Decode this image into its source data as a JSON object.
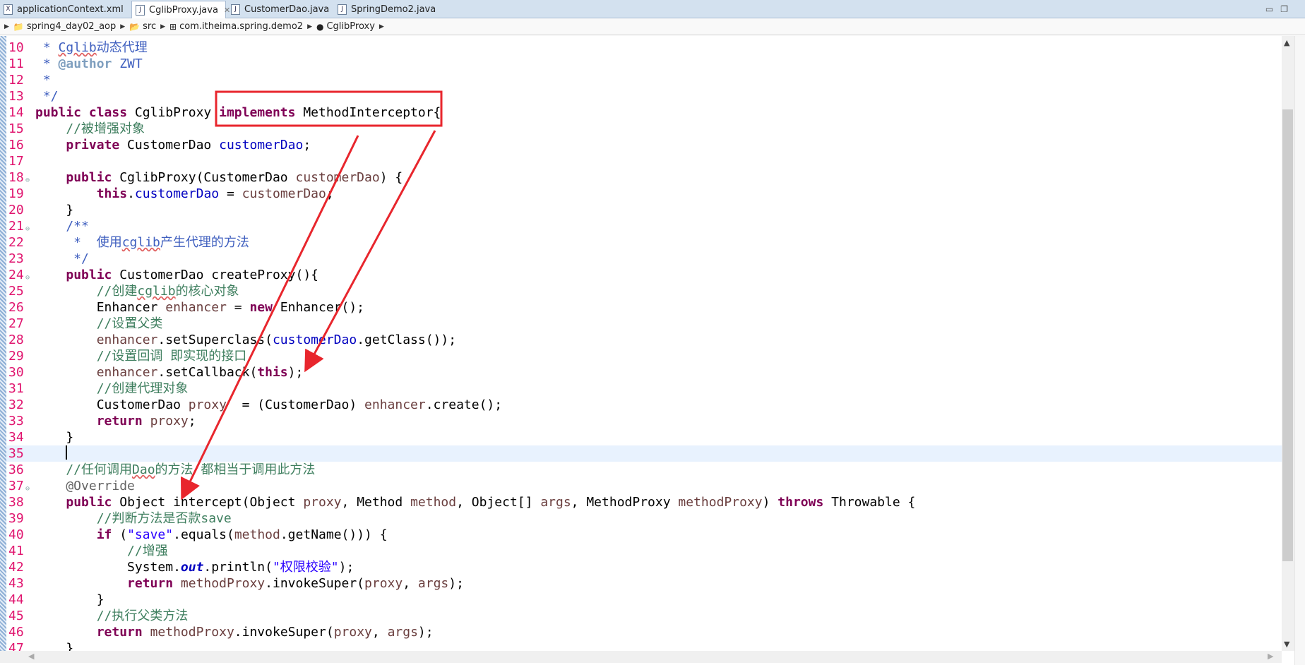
{
  "tabs": [
    {
      "label": "applicationContext.xml",
      "icon": "xml-file-icon",
      "glyph": "X",
      "active": false
    },
    {
      "label": "CglibProxy.java",
      "icon": "java-file-icon",
      "glyph": "J",
      "active": true,
      "close": "✕"
    },
    {
      "label": "CustomerDao.java",
      "icon": "java-file-icon",
      "glyph": "J",
      "active": false
    },
    {
      "label": "SpringDemo2.java",
      "icon": "java-file-icon",
      "glyph": "J",
      "active": false
    }
  ],
  "window_controls": {
    "minimize": "▭",
    "restore": "❐"
  },
  "breadcrumb": [
    {
      "label": "spring4_day02_aop",
      "icon": "project-icon",
      "glyph": "📁"
    },
    {
      "label": "src",
      "icon": "source-folder-icon",
      "glyph": "📂"
    },
    {
      "label": "com.itheima.spring.demo2",
      "icon": "package-icon",
      "glyph": "⊞"
    },
    {
      "label": "CglibProxy",
      "icon": "class-icon",
      "glyph": "●"
    }
  ],
  "colors": {
    "annotation": "#e8262d",
    "keyword": "#7f0055",
    "comment": "#3f7f5f",
    "line_number": "#e0146e"
  },
  "code": {
    "first_line": 10,
    "current_line": 35,
    "folds": [
      18,
      21,
      24,
      37
    ],
    "lines": [
      [
        [
          " * ",
          "jd"
        ],
        [
          "Cglib",
          "jd sq"
        ],
        [
          "动态代理",
          "jd"
        ]
      ],
      [
        [
          " * ",
          "jd"
        ],
        [
          "@author",
          "tag"
        ],
        [
          " ZWT",
          "jd"
        ]
      ],
      [
        [
          " *",
          "jd"
        ]
      ],
      [
        [
          " */",
          "jd"
        ]
      ],
      [
        [
          "public",
          "kw"
        ],
        [
          " ",
          ""
        ],
        [
          "class",
          "kw"
        ],
        [
          " CglibProxy ",
          ""
        ],
        [
          "implements",
          "kw"
        ],
        [
          " MethodInterceptor{",
          ""
        ]
      ],
      [
        [
          "    //被增强对象",
          "cm"
        ]
      ],
      [
        [
          "    ",
          ""
        ],
        [
          "private",
          "kw"
        ],
        [
          " CustomerDao ",
          ""
        ],
        [
          "customerDao",
          "fld"
        ],
        [
          ";",
          ""
        ]
      ],
      [],
      [
        [
          "    ",
          ""
        ],
        [
          "public",
          "kw"
        ],
        [
          " CglibProxy(CustomerDao ",
          ""
        ],
        [
          "customerDao",
          "loc"
        ],
        [
          ") {",
          ""
        ]
      ],
      [
        [
          "        ",
          ""
        ],
        [
          "this",
          "kw"
        ],
        [
          ".",
          ""
        ],
        [
          "customerDao",
          "fld"
        ],
        [
          " = ",
          ""
        ],
        [
          "customerDao",
          "loc"
        ],
        [
          ";",
          ""
        ]
      ],
      [
        [
          "    }",
          ""
        ]
      ],
      [
        [
          "    /**",
          "jd"
        ]
      ],
      [
        [
          "     *  使用",
          "jd"
        ],
        [
          "cglib",
          "jd sq"
        ],
        [
          "产生代理的方法",
          "jd"
        ]
      ],
      [
        [
          "     */",
          "jd"
        ]
      ],
      [
        [
          "    ",
          ""
        ],
        [
          "public",
          "kw"
        ],
        [
          " CustomerDao createProxy(){",
          ""
        ]
      ],
      [
        [
          "        //创建",
          "cm"
        ],
        [
          "cglib",
          "cm sq"
        ],
        [
          "的核心对象",
          "cm"
        ]
      ],
      [
        [
          "        Enhancer ",
          ""
        ],
        [
          "enhancer",
          "loc"
        ],
        [
          " = ",
          ""
        ],
        [
          "new",
          "kw"
        ],
        [
          " Enhancer();",
          ""
        ]
      ],
      [
        [
          "        //设置父类",
          "cm"
        ]
      ],
      [
        [
          "        ",
          ""
        ],
        [
          "enhancer",
          "loc"
        ],
        [
          ".setSuperclass(",
          ""
        ],
        [
          "customerDao",
          "fld"
        ],
        [
          ".getClass());",
          ""
        ]
      ],
      [
        [
          "        //设置回调 即实现的接口",
          "cm"
        ]
      ],
      [
        [
          "        ",
          ""
        ],
        [
          "enhancer",
          "loc"
        ],
        [
          ".setCallback(",
          ""
        ],
        [
          "this",
          "kw"
        ],
        [
          ");",
          ""
        ]
      ],
      [
        [
          "        //创建代理对象",
          "cm"
        ]
      ],
      [
        [
          "        CustomerDao ",
          ""
        ],
        [
          "proxy",
          "loc"
        ],
        [
          "  = (CustomerDao) ",
          ""
        ],
        [
          "enhancer",
          "loc"
        ],
        [
          ".create();",
          ""
        ]
      ],
      [
        [
          "        ",
          ""
        ],
        [
          "return",
          "kw"
        ],
        [
          " ",
          ""
        ],
        [
          "proxy",
          "loc"
        ],
        [
          ";",
          ""
        ]
      ],
      [
        [
          "    }",
          ""
        ]
      ],
      [],
      [
        [
          "    //任何调用",
          "cm"
        ],
        [
          "Dao",
          "cm sq"
        ],
        [
          "的方法 都相当于调用此方法",
          "cm"
        ]
      ],
      [
        [
          "    @Override",
          "ann"
        ]
      ],
      [
        [
          "    ",
          ""
        ],
        [
          "public",
          "kw"
        ],
        [
          " Object intercept(Object ",
          ""
        ],
        [
          "proxy",
          "loc"
        ],
        [
          ", Method ",
          ""
        ],
        [
          "method",
          "loc"
        ],
        [
          ", Object[] ",
          ""
        ],
        [
          "args",
          "loc"
        ],
        [
          ", MethodProxy ",
          ""
        ],
        [
          "methodProxy",
          "loc"
        ],
        [
          ") ",
          ""
        ],
        [
          "throws",
          "kw"
        ],
        [
          " Throwable {",
          ""
        ]
      ],
      [
        [
          "        //判断方法是否款save",
          "cm"
        ]
      ],
      [
        [
          "        ",
          ""
        ],
        [
          "if",
          "kw"
        ],
        [
          " (",
          ""
        ],
        [
          "\"save\"",
          "str"
        ],
        [
          ".equals(",
          ""
        ],
        [
          "method",
          "loc"
        ],
        [
          ".getName())) {",
          ""
        ]
      ],
      [
        [
          "            //增强",
          "cm"
        ]
      ],
      [
        [
          "            System.",
          ""
        ],
        [
          "out",
          "st"
        ],
        [
          ".println(",
          ""
        ],
        [
          "\"权限校验\"",
          "str"
        ],
        [
          ");",
          ""
        ]
      ],
      [
        [
          "            ",
          ""
        ],
        [
          "return",
          "kw"
        ],
        [
          " ",
          ""
        ],
        [
          "methodProxy",
          "loc"
        ],
        [
          ".invokeSuper(",
          ""
        ],
        [
          "proxy",
          "loc"
        ],
        [
          ", ",
          ""
        ],
        [
          "args",
          "loc"
        ],
        [
          ");",
          ""
        ]
      ],
      [
        [
          "        }",
          ""
        ]
      ],
      [
        [
          "        //执行父类方法",
          "cm"
        ]
      ],
      [
        [
          "        ",
          ""
        ],
        [
          "return",
          "kw"
        ],
        [
          " ",
          ""
        ],
        [
          "methodProxy",
          "loc"
        ],
        [
          ".invokeSuper(",
          ""
        ],
        [
          "proxy",
          "loc"
        ],
        [
          ", ",
          ""
        ],
        [
          "args",
          "loc"
        ],
        [
          ");",
          ""
        ]
      ],
      [
        [
          "    }",
          ""
        ]
      ]
    ]
  }
}
